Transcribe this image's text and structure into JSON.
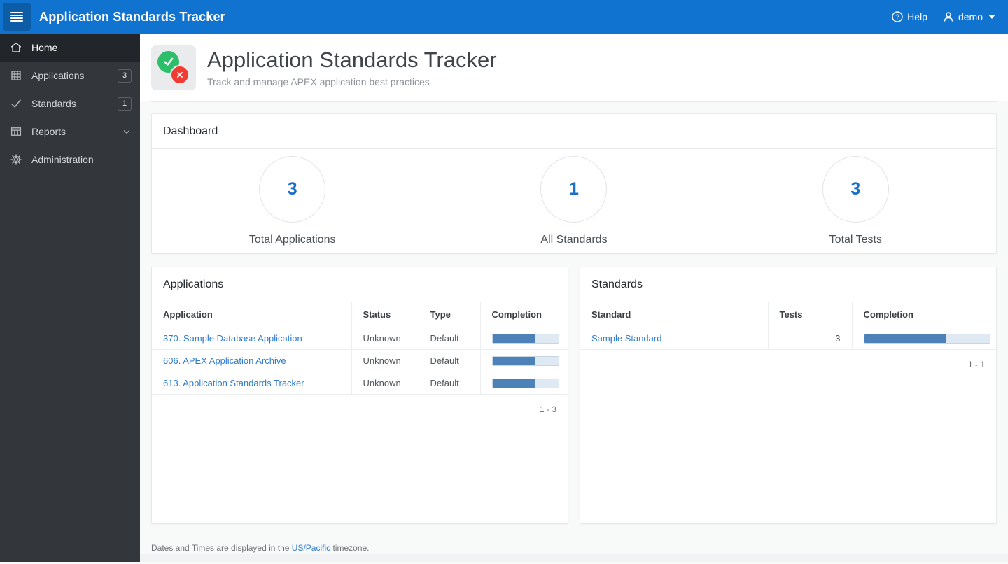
{
  "header": {
    "title": "Application Standards Tracker",
    "help_label": "Help",
    "user_name": "demo"
  },
  "sidebar": {
    "items": [
      {
        "label": "Home",
        "icon": "home",
        "active": true
      },
      {
        "label": "Applications",
        "icon": "grid",
        "badge": "3"
      },
      {
        "label": "Standards",
        "icon": "check",
        "badge": "1"
      },
      {
        "label": "Reports",
        "icon": "table",
        "expandable": true
      },
      {
        "label": "Administration",
        "icon": "gear"
      }
    ]
  },
  "page_header": {
    "title": "Application Standards Tracker",
    "subtitle": "Track and manage APEX application best practices"
  },
  "dashboard": {
    "title": "Dashboard",
    "metrics": [
      {
        "value": "3",
        "label": "Total Applications"
      },
      {
        "value": "1",
        "label": "All Standards"
      },
      {
        "value": "3",
        "label": "Total Tests"
      }
    ]
  },
  "applications": {
    "title": "Applications",
    "columns": {
      "application": "Application",
      "status": "Status",
      "type": "Type",
      "completion": "Completion"
    },
    "rows": [
      {
        "application": "370. Sample Database Application",
        "status": "Unknown",
        "type": "Default",
        "completion_pct": 65
      },
      {
        "application": "606. APEX Application Archive",
        "status": "Unknown",
        "type": "Default",
        "completion_pct": 65
      },
      {
        "application": "613. Application Standards Tracker",
        "status": "Unknown",
        "type": "Default",
        "completion_pct": 65
      }
    ],
    "pagination": "1 - 3"
  },
  "standards": {
    "title": "Standards",
    "columns": {
      "standard": "Standard",
      "tests": "Tests",
      "completion": "Completion"
    },
    "rows": [
      {
        "standard": "Sample Standard",
        "tests": "3",
        "completion_pct": 65
      }
    ],
    "pagination": "1 - 1"
  },
  "footer": {
    "text_before": "Dates and Times are displayed in the ",
    "link": "US/Pacific",
    "text_after": " timezone."
  },
  "colors": {
    "accent": "#1173d0",
    "accent-dark": "#0d5da6",
    "sidebar-bg": "#33363b",
    "sidebar-active": "#222529",
    "content-bg": "#f8f9f9",
    "link": "#2e7bcf",
    "metric-blue": "#1a6fc9",
    "bar-fill": "#4d82b8",
    "bar-track": "#dfe9f4",
    "green": "#2dbe6a",
    "red": "#f13c33"
  }
}
